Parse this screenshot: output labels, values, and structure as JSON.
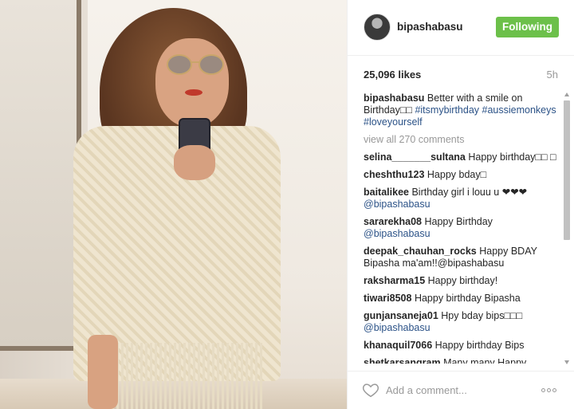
{
  "post": {
    "username": "bipashabasu",
    "follow_label": "Following",
    "likes": "25,096 likes",
    "time": "5h"
  },
  "caption": {
    "username": "bipashabasu",
    "text": "Better with a smile on Birthday□□",
    "hashtags": [
      "#itsmybirthday",
      "#aussiemonkeys",
      "#loveyourself"
    ]
  },
  "view_all": "view all 270 comments",
  "comments": [
    {
      "user": "selina_______sultana",
      "text": "Happy birthday□□\n□",
      "mention": ""
    },
    {
      "user": "cheshthu123",
      "text": "Happy bday□",
      "mention": ""
    },
    {
      "user": "baitalikee",
      "text": "Birthday girl i louu u ❤❤❤",
      "mention": "@bipashabasu"
    },
    {
      "user": "sararekha08",
      "text": "Happy Birthday",
      "mention": "@bipashabasu"
    },
    {
      "user": "deepak_chauhan_rocks",
      "text": "Happy BDAY Bipasha ma'am!!@bipashabasu",
      "mention": ""
    },
    {
      "user": "raksharma15",
      "text": "Happy birthday!",
      "mention": ""
    },
    {
      "user": "tiwari8508",
      "text": "Happy birthday Bipasha",
      "mention": ""
    },
    {
      "user": "gunjansaneja01",
      "text": "Hpy bday bips□□□",
      "mention": "@bipashabasu"
    },
    {
      "user": "khanaquil7066",
      "text": "Happy birthday Bips",
      "mention": ""
    },
    {
      "user": "shetkarsangram",
      "text": "Many many Happy",
      "mention": ""
    }
  ],
  "footer": {
    "add_comment_placeholder": "Add a comment..."
  },
  "icons": {
    "like": "heart-icon",
    "more": "more-options-icon"
  },
  "colors": {
    "follow_button": "#6cc04a",
    "link": "#2b5287",
    "muted": "#999999"
  }
}
